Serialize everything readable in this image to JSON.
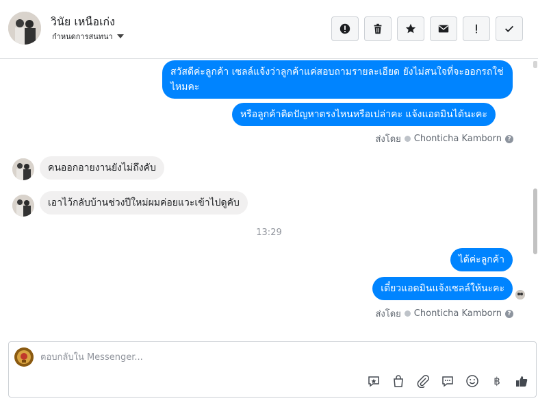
{
  "header": {
    "contact_name": "วินัย เหนือเก่ง",
    "assign_label": "กำหนดการสนทนา",
    "actions": [
      {
        "name": "spam-button",
        "icon": "alert-circle-icon"
      },
      {
        "name": "delete-button",
        "icon": "trash-icon"
      },
      {
        "name": "star-button",
        "icon": "star-icon"
      },
      {
        "name": "mark-unread-button",
        "icon": "envelope-icon"
      },
      {
        "name": "follow-up-button",
        "icon": "exclamation-icon"
      },
      {
        "name": "done-button",
        "icon": "check-icon"
      }
    ]
  },
  "thread": {
    "messages": [
      {
        "from": "page",
        "text": "สวัสดีค่ะลูกค้า เซลล์แจ้งว่าลูกค้าแค่สอบถามรายละเอียด ยังไม่สนใจที่จะออกรถใช่ไหมคะ"
      },
      {
        "from": "page",
        "text": "หรือลูกค้าติดปัญหาตรงไหนหรือเปล่าคะ แจ้งแอดมินได้นะคะ"
      },
      {
        "from": "customer",
        "text": "คนออกอายงานยังไม่ถึงคับ"
      },
      {
        "from": "customer",
        "text": "เอาไว้กลับบ้านช่วงปีใหม่ผมค่อยแวะเข้าไปดูคับ"
      },
      {
        "from": "page",
        "text": "ได้ค่ะลูกค้า"
      },
      {
        "from": "page",
        "text": "เดี๋ยวแอดมินแจ้งเซลล์ให้นะคะ"
      }
    ],
    "sent_by_prefix": "ส่งโดย",
    "sent_by_name": "Chonticha Kamborn",
    "timestamp": "13:29"
  },
  "composer": {
    "placeholder": "ตอบกลับใน Messenger...",
    "tools": [
      "saved-reply-icon",
      "shop-bag-icon",
      "attachment-icon",
      "chat-bubble-icon",
      "emoji-icon",
      "baht-icon",
      "thumbs-up-icon"
    ],
    "baht_symbol": "฿"
  },
  "colors": {
    "outgoing_bubble": "#0084ff",
    "incoming_bubble": "#f1f0f0",
    "border": "#ccd0d5"
  }
}
